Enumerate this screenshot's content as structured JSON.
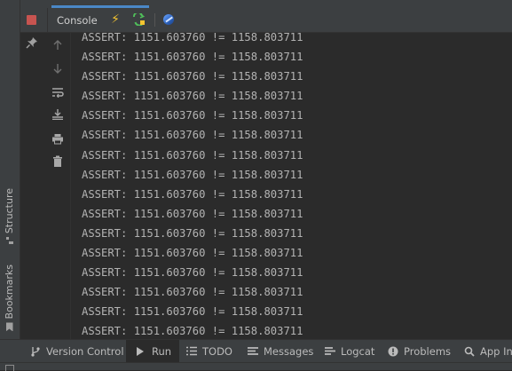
{
  "left_strip": {
    "structure_label": "Structure",
    "bookmarks_label": "Bookmarks"
  },
  "run_panel": {
    "console_tab_label": "Console",
    "colors": {
      "stop": "#c75450",
      "accent": "#4a88c7",
      "bolt": "#f4c430"
    },
    "output_lines": [
      "ASSERT: 1151.603760 != 1158.803711",
      "ASSERT: 1151.603760 != 1158.803711",
      "ASSERT: 1151.603760 != 1158.803711",
      "ASSERT: 1151.603760 != 1158.803711",
      "ASSERT: 1151.603760 != 1158.803711",
      "ASSERT: 1151.603760 != 1158.803711",
      "ASSERT: 1151.603760 != 1158.803711",
      "ASSERT: 1151.603760 != 1158.803711",
      "ASSERT: 1151.603760 != 1158.803711",
      "ASSERT: 1151.603760 != 1158.803711",
      "ASSERT: 1151.603760 != 1158.803711",
      "ASSERT: 1151.603760 != 1158.803711",
      "ASSERT: 1151.603760 != 1158.803711",
      "ASSERT: 1151.603760 != 1158.803711",
      "ASSERT: 1151.603760 != 1158.803711",
      "ASSERT: 1151.603760 != 1158.803711"
    ]
  },
  "bottom_bar": {
    "version_control": "Version Control",
    "run": "Run",
    "todo": "TODO",
    "messages": "Messages",
    "logcat": "Logcat",
    "problems": "Problems",
    "app_inspection": "App Ins"
  }
}
